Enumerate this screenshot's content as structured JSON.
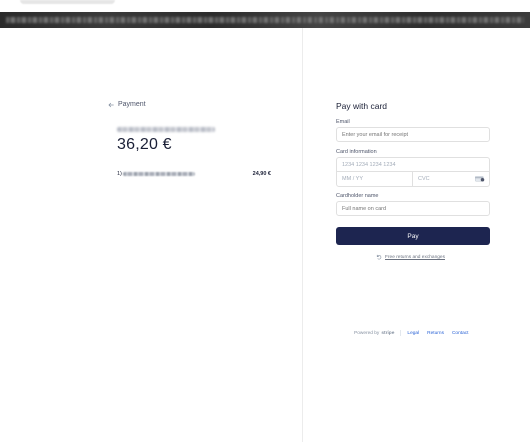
{
  "left": {
    "back_label": "Payment",
    "amount": "36,20 €",
    "line_item": {
      "qty": "1)",
      "price": "24,90 €"
    }
  },
  "right": {
    "title": "Pay with card",
    "email_label": "Email",
    "email_placeholder": "Enter your email for receipt",
    "card_label": "Card information",
    "card_number_placeholder": "1234 1234 1234 1234",
    "expiry_placeholder": "MM / YY",
    "cvc_placeholder": "CVC",
    "cardholder_label": "Cardholder name",
    "cardholder_placeholder": "Full name on card",
    "pay_button": "Pay",
    "returns_link": "Free returns and exchanges"
  },
  "footer": {
    "powered_by": "Powered by",
    "brand": "stripe",
    "links": [
      "Legal",
      "Returns",
      "Contact"
    ]
  },
  "colors": {
    "pay_button_bg": "#1d2550",
    "link": "#2a63d6"
  },
  "icons": [
    "arrow-left-icon",
    "cvc-card-icon",
    "returns-icon"
  ]
}
